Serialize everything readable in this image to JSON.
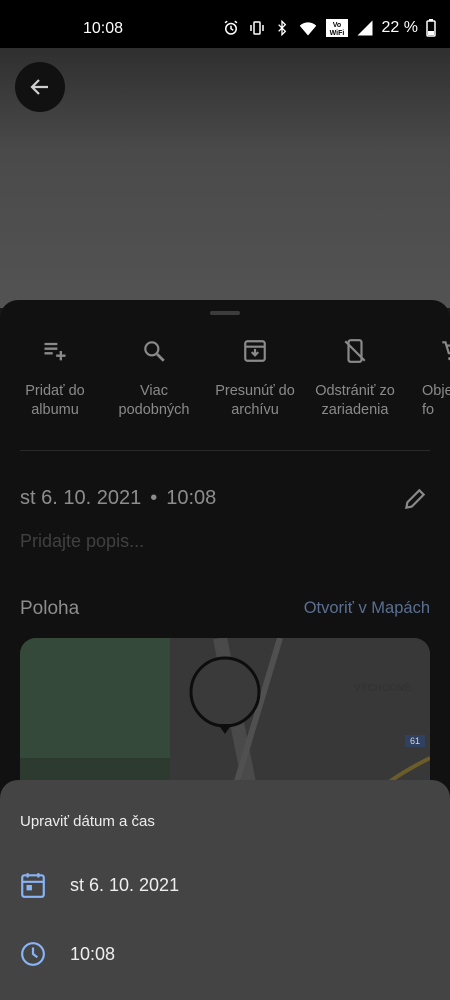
{
  "status": {
    "time": "10:08",
    "battery": "22 %"
  },
  "actions": [
    {
      "icon": "playlist-add-icon",
      "label": "Pridať do albumu"
    },
    {
      "icon": "search-icon",
      "label": "Viac podobných"
    },
    {
      "icon": "archive-icon",
      "label": "Presunúť do archívu"
    },
    {
      "icon": "phone-remove-icon",
      "label": "Odstrániť zo zariadenia"
    },
    {
      "icon": "cart-icon",
      "label": "Obje fo"
    }
  ],
  "info": {
    "date": "st 6. 10. 2021",
    "separator": "•",
    "time": "10:08",
    "description_placeholder": "Pridajte popis..."
  },
  "location": {
    "title": "Poloha",
    "open_maps": "Otvoriť v Mapách",
    "map_label": "VÝCHODNÉ",
    "road_badge": "61"
  },
  "dialog": {
    "title": "Upraviť dátum a čas",
    "date": "st 6. 10. 2021",
    "time": "10:08"
  },
  "colors": {
    "accent": "#8ab4f8",
    "dialog_bg": "#444444",
    "sheet_bg": "#111111"
  }
}
